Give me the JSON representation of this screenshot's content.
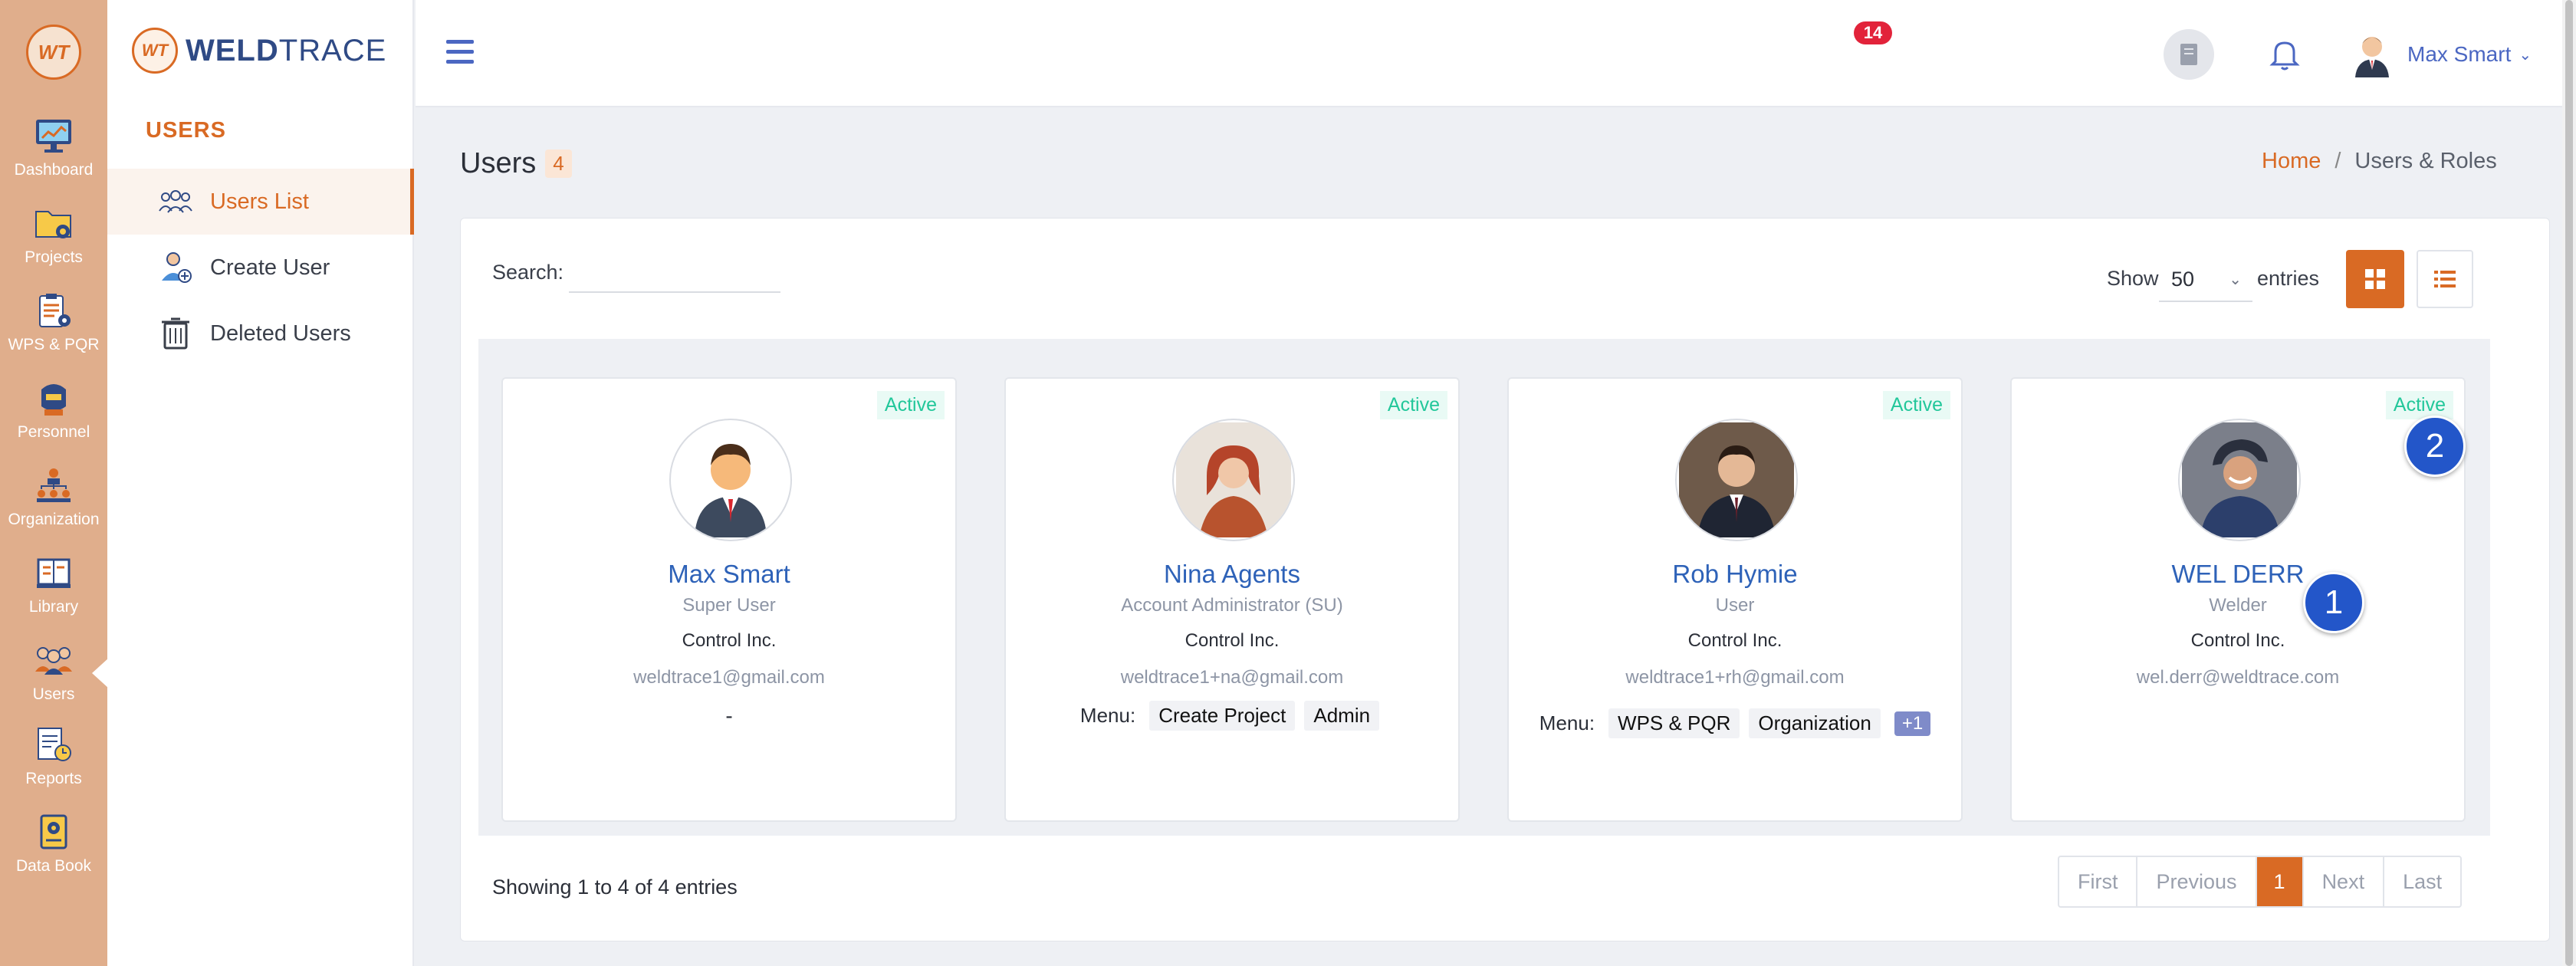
{
  "app": {
    "brand_bold": "WELD",
    "brand_light": "TRACE",
    "logo_text": "WT"
  },
  "rail": {
    "items": [
      {
        "label": "Dashboard",
        "icon": "monitor-icon"
      },
      {
        "label": "Projects",
        "icon": "folder-gear-icon"
      },
      {
        "label": "WPS & PQR",
        "icon": "clipboard-gear-icon"
      },
      {
        "label": "Personnel",
        "icon": "welder-mask-icon"
      },
      {
        "label": "Organization",
        "icon": "org-chart-icon"
      },
      {
        "label": "Library",
        "icon": "book-icon"
      },
      {
        "label": "Users",
        "icon": "users-group-icon"
      },
      {
        "label": "Reports",
        "icon": "report-clock-icon"
      },
      {
        "label": "Data Book",
        "icon": "data-book-icon"
      }
    ]
  },
  "sidebar": {
    "section_title": "USERS",
    "items": [
      {
        "label": "Users List",
        "icon": "users-list-icon",
        "active": true
      },
      {
        "label": "Create User",
        "icon": "create-user-icon",
        "active": false
      },
      {
        "label": "Deleted Users",
        "icon": "trash-icon",
        "active": false
      }
    ]
  },
  "topbar": {
    "notification_count": "14",
    "user_name": "Max Smart",
    "caret": "⌄"
  },
  "page": {
    "title": "Users",
    "count": "4",
    "breadcrumb": {
      "home": "Home",
      "separator": "/",
      "current": "Users & Roles"
    }
  },
  "toolbar": {
    "search_label": "Search:",
    "search_value": "",
    "show_label": "Show",
    "show_value": "50",
    "entries_label": "entries"
  },
  "users": [
    {
      "status": "Active",
      "name": "Max Smart",
      "role": "Super User",
      "company": "Control Inc.",
      "email": "weldtrace1@gmail.com",
      "menu_label": "",
      "menus": [],
      "more": "",
      "empty_menu": "-"
    },
    {
      "status": "Active",
      "name": "Nina Agents",
      "role": "Account Administrator (SU)",
      "company": "Control Inc.",
      "email": "weldtrace1+na@gmail.com",
      "menu_label": "Menu:",
      "menus": [
        "Create Project",
        "Admin"
      ],
      "more": "",
      "empty_menu": ""
    },
    {
      "status": "Active",
      "name": "Rob Hymie",
      "role": "User",
      "company": "Control Inc.",
      "email": "weldtrace1+rh@gmail.com",
      "menu_label": "Menu:",
      "menus": [
        "WPS & PQR",
        "Organization"
      ],
      "more": "+1",
      "empty_menu": ""
    },
    {
      "status": "Active",
      "name": "WEL DERR",
      "role": "Welder",
      "company": "Control Inc.",
      "email": "wel.derr@weldtrace.com",
      "menu_label": "",
      "menus": [],
      "more": "",
      "empty_menu": ""
    }
  ],
  "markers": {
    "first": "1",
    "second": "2"
  },
  "footer": {
    "showing": "Showing 1 to 4 of 4 entries",
    "pager": {
      "first": "First",
      "previous": "Previous",
      "current": "1",
      "next": "Next",
      "last": "Last"
    }
  },
  "colors": {
    "accent": "#d96a24",
    "rail": "#e0ae8c",
    "link": "#2e62b8",
    "active_status": "#22c79a",
    "marker": "#2356c9"
  }
}
